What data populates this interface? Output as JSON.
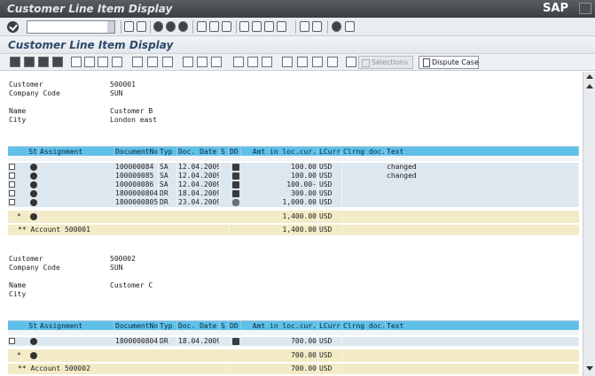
{
  "window": {
    "title": "Customer Line Item Display",
    "logo": "SAP"
  },
  "command_field": {
    "value": ""
  },
  "screen": {
    "title": "Customer Line Item Display"
  },
  "toolbar": {
    "selections_label": "Selections",
    "dispute_label": "Dispute Case"
  },
  "columns": [
    "St",
    "Assignment",
    "DocumentNo",
    "Typ",
    "Doc. Date",
    "S",
    "DD",
    "Amt in loc.cur.",
    "LCurr",
    "Clrng doc.",
    "Text"
  ],
  "blocks": [
    {
      "header": [
        {
          "label": "Customer",
          "value": "500001"
        },
        {
          "label": "Company Code",
          "value": "SUN"
        },
        {
          "label": "Name",
          "value": "Customer B"
        },
        {
          "label": "City",
          "value": "London east"
        }
      ],
      "rows": [
        {
          "doc": "100000084",
          "typ": "SA",
          "date": "12.04.2009",
          "amount": "100.00",
          "curr": "USD",
          "text": "changed"
        },
        {
          "doc": "100000085",
          "typ": "SA",
          "date": "12.04.2009",
          "amount": "100.00",
          "curr": "USD",
          "text": "changed"
        },
        {
          "doc": "100000086",
          "typ": "SA",
          "date": "12.04.2009",
          "amount": "100.00-",
          "curr": "USD",
          "text": ""
        },
        {
          "doc": "1800000804",
          "typ": "DR",
          "date": "18.04.2009",
          "amount": "300.00",
          "curr": "USD",
          "text": ""
        },
        {
          "doc": "1800000805",
          "typ": "DR",
          "date": "23.04.2009",
          "amount": "1,000.00",
          "curr": "USD",
          "text": ""
        }
      ],
      "total": {
        "marker": "*",
        "amount": "1,400.00",
        "curr": "USD"
      },
      "subtotal": {
        "label": "** Account 500001",
        "amount": "1,400.00",
        "curr": "USD"
      }
    },
    {
      "header": [
        {
          "label": "Customer",
          "value": "500002"
        },
        {
          "label": "Company Code",
          "value": "SUN"
        },
        {
          "label": "Name",
          "value": "Customer C"
        },
        {
          "label": "City",
          "value": ""
        }
      ],
      "rows": [
        {
          "doc": "1800000804",
          "typ": "DR",
          "date": "18.04.2009",
          "amount": "700.00",
          "curr": "USD",
          "text": ""
        }
      ],
      "total": {
        "marker": "*",
        "amount": "700.00",
        "curr": "USD"
      },
      "subtotal": {
        "label": "** Account 500002",
        "amount": "700.00",
        "curr": "USD"
      }
    }
  ]
}
